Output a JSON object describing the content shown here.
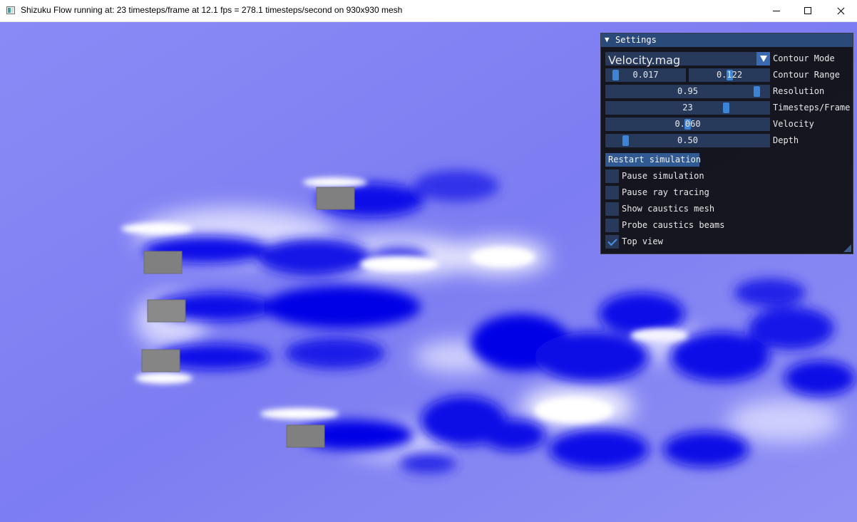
{
  "window": {
    "title": "Shizuku Flow running at: 23 timesteps/frame at 12.1 fps = 278.1 timesteps/second on 930x930 mesh"
  },
  "settings": {
    "header": "Settings",
    "contour_mode": {
      "value": "Velocity.mag",
      "label": "Contour Mode"
    },
    "contour_range": {
      "min": "0.017",
      "max": "0.122",
      "label": "Contour Range"
    },
    "resolution": {
      "value": "0.95",
      "label": "Resolution",
      "fraction": 0.95
    },
    "timesteps_per_frame": {
      "value": "23",
      "label": "Timesteps/Frame"
    },
    "velocity": {
      "value": "0.060",
      "label": "Velocity"
    },
    "depth": {
      "value": "0.50",
      "label": "Depth"
    },
    "restart_button": "Restart simulation",
    "checkboxes": [
      {
        "label": "Pause simulation",
        "checked": false
      },
      {
        "label": "Pause ray tracing",
        "checked": false
      },
      {
        "label": "Show caustics mesh",
        "checked": false
      },
      {
        "label": "Probe caustics beams",
        "checked": false
      },
      {
        "label": "Top view",
        "checked": true
      }
    ]
  },
  "colors": {
    "fluid_background": "#8080f4",
    "vortex_core": "#0000e6",
    "high_speed": "#ffffff",
    "obstacle": "#808080",
    "panel_accent": "#3d84d6"
  }
}
